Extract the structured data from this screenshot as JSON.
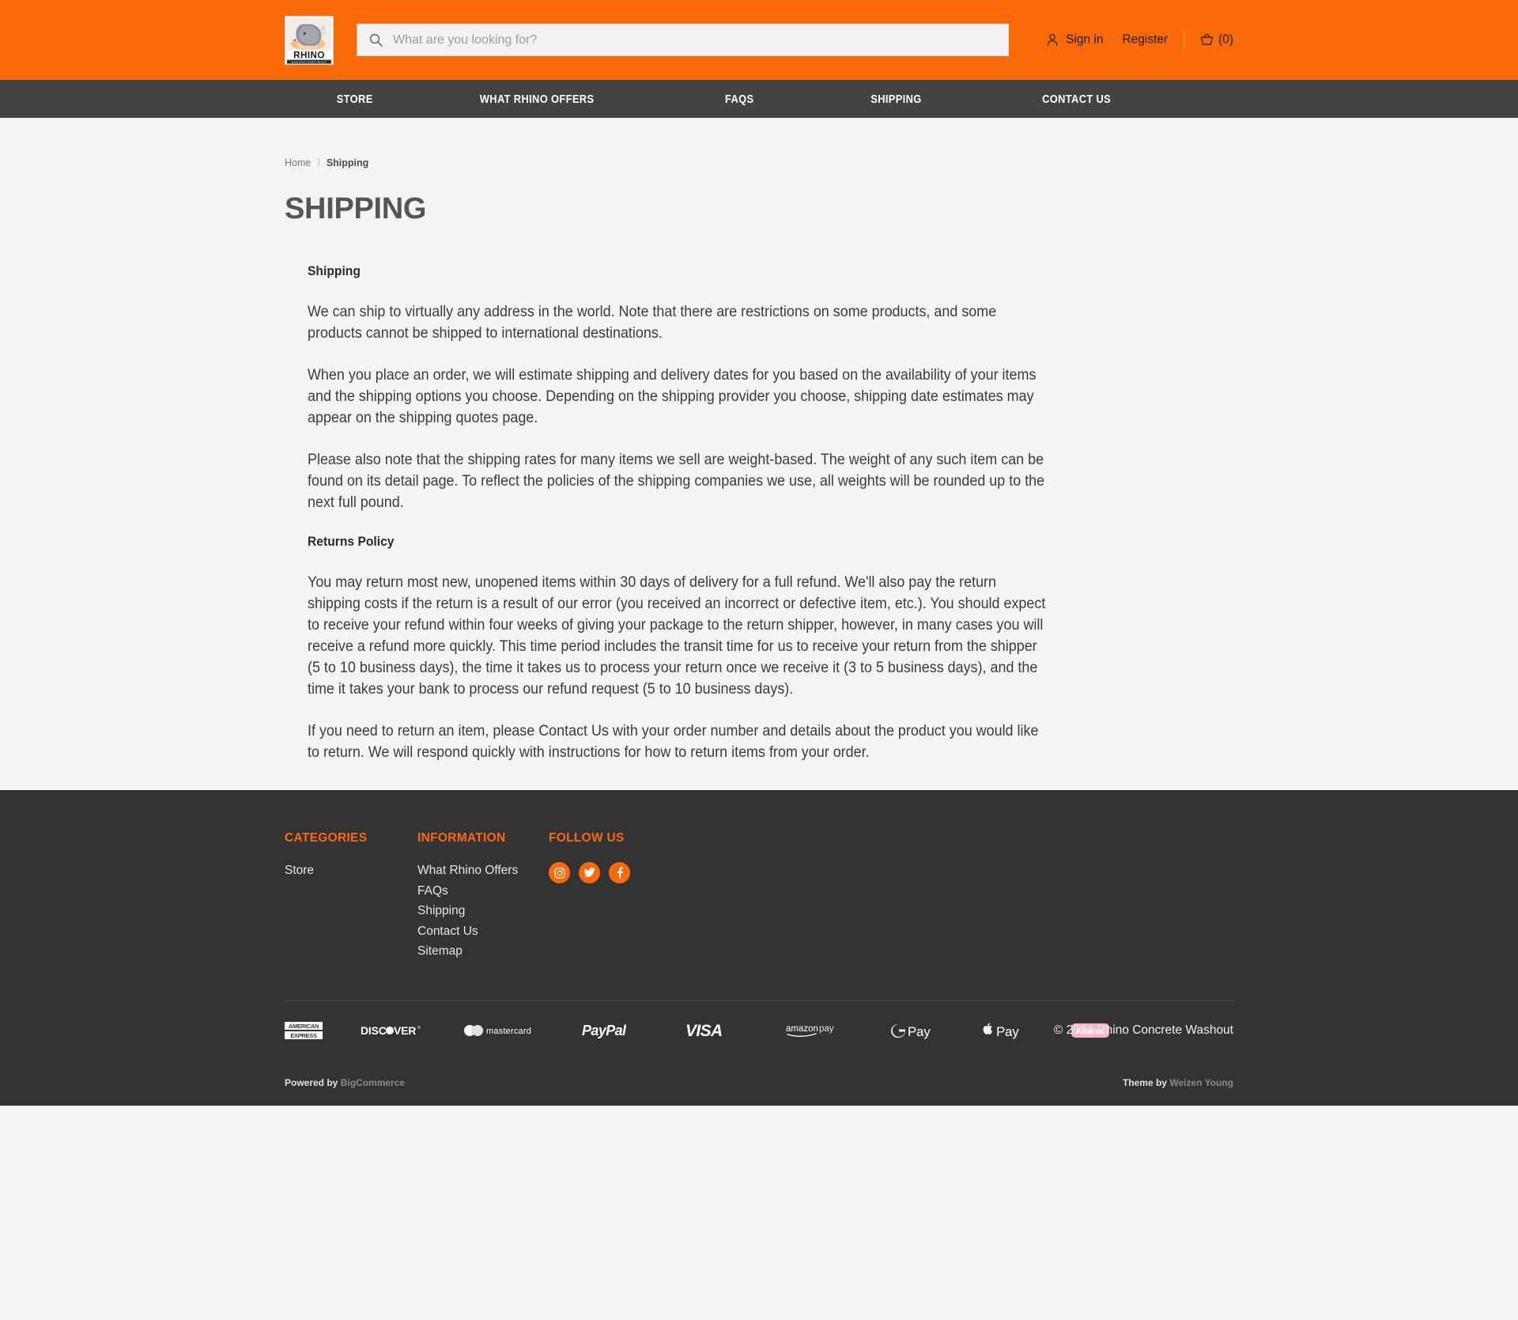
{
  "header": {
    "logo_alt": "Rhino Manufacturing Group",
    "logo_text_main": "RHINO",
    "logo_text_sub": "MANUFACTURING GROUP",
    "search_placeholder": "What are you looking for?",
    "search_value": "",
    "sign_in": "Sign in",
    "or": "or",
    "register": "Register",
    "cart_count": "(0)",
    "brand_color": "#fb6a08"
  },
  "nav": {
    "items": [
      {
        "label": "Store"
      },
      {
        "label": "What Rhino Offers"
      },
      {
        "label": "FAQs"
      },
      {
        "label": "Shipping"
      },
      {
        "label": "Contact Us"
      }
    ]
  },
  "breadcrumb": {
    "home": "Home",
    "separator": "/",
    "current": "Shipping"
  },
  "page": {
    "title": "SHIPPING",
    "sections": [
      {
        "heading": "Shipping",
        "paragraphs": [
          "We can ship to virtually any address in the world. Note that there are restrictions on some products, and some products cannot be shipped to international destinations.",
          "When you place an order, we will estimate shipping and delivery dates for you based on the availability of your items and the shipping options you choose. Depending on the shipping provider you choose, shipping date estimates may appear on the shipping quotes page.",
          "Please also note that the shipping rates for many items we sell are weight-based. The weight of any such item can be found on its detail page. To reflect the policies of the shipping companies we use, all weights will be rounded up to the next full pound."
        ]
      },
      {
        "heading": "Returns Policy",
        "paragraphs": [
          "You may return most new, unopened items within 30 days of delivery for a full refund. We'll also pay the return shipping costs if the return is a result of our error (you received an incorrect or defective item, etc.).\nYou should expect to receive your refund within four weeks of giving your package to the return shipper, however, in many cases you will receive a refund more quickly. This time period includes the transit time for us to receive your return from the shipper (5 to 10 business days), the time it takes us to process your return once we receive it (3 to 5 business days), and the time it takes your bank to process our refund request (5 to 10 business days).",
          "If you need to return an item, please Contact Us with your order number and details about the product you would like to return. We will respond quickly with instructions for how to return items from your order."
        ]
      }
    ]
  },
  "footer": {
    "categories": {
      "heading": "Categories",
      "links": [
        {
          "label": "Store"
        }
      ]
    },
    "information": {
      "heading": "Information",
      "links": [
        {
          "label": "What Rhino Offers"
        },
        {
          "label": "FAQs"
        },
        {
          "label": "Shipping"
        },
        {
          "label": "Contact Us"
        },
        {
          "label": "Sitemap"
        }
      ]
    },
    "follow": {
      "heading": "Follow Us",
      "socials": [
        {
          "name": "instagram-icon",
          "label": "Instagram"
        },
        {
          "name": "twitter-icon",
          "label": "Twitter"
        },
        {
          "name": "facebook-icon",
          "label": "Facebook"
        }
      ]
    },
    "payments": [
      {
        "name": "american-express-icon",
        "label": "American Express"
      },
      {
        "name": "discover-icon",
        "label": "Discover"
      },
      {
        "name": "mastercard-icon",
        "label": "mastercard"
      },
      {
        "name": "paypal-icon",
        "label": "PayPal"
      },
      {
        "name": "visa-icon",
        "label": "VISA"
      },
      {
        "name": "amazon-pay-icon",
        "label": "amazon pay"
      },
      {
        "name": "google-pay-icon",
        "label": "G Pay"
      },
      {
        "name": "apple-pay-icon",
        "label": "Apple Pay"
      },
      {
        "name": "klarna-icon",
        "label": "Klarna."
      }
    ],
    "copyright": "© 2024 Rhino Concrete Washout",
    "powered_by_label": "Powered by",
    "powered_by_name": "BigCommerce",
    "theme_by_label": "Theme by",
    "theme_by_name": "Weizen Young"
  }
}
